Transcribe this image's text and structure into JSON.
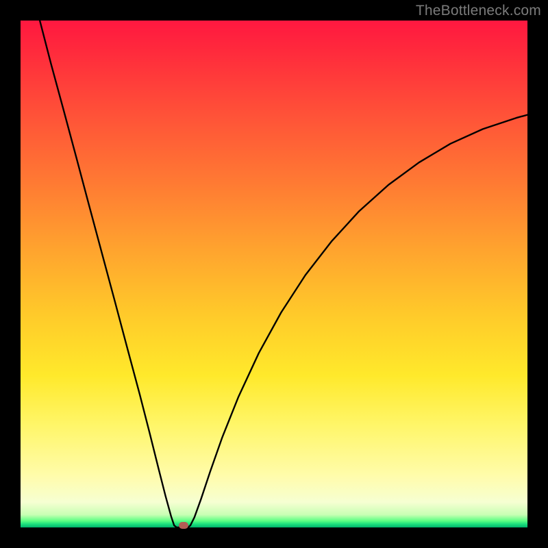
{
  "watermark": "TheBottleneck.com",
  "chart_data": {
    "type": "line",
    "title": "",
    "xlabel": "",
    "ylabel": "",
    "xlim": [
      0,
      1
    ],
    "ylim": [
      0,
      1
    ],
    "grid": false,
    "legend": false,
    "line_color": "#000000",
    "gradient_stops": [
      {
        "pos": 0.0,
        "color": "#ff1840"
      },
      {
        "pos": 0.18,
        "color": "#ff5038"
      },
      {
        "pos": 0.46,
        "color": "#ffa62e"
      },
      {
        "pos": 0.7,
        "color": "#ffe92b"
      },
      {
        "pos": 0.9,
        "color": "#fffcac"
      },
      {
        "pos": 0.985,
        "color": "#5cff83"
      },
      {
        "pos": 1.0,
        "color": "#00b36b"
      }
    ],
    "left_branch": [
      {
        "x": 0.038,
        "y": 1.0
      },
      {
        "x": 0.06,
        "y": 0.915
      },
      {
        "x": 0.085,
        "y": 0.823
      },
      {
        "x": 0.11,
        "y": 0.73
      },
      {
        "x": 0.135,
        "y": 0.636
      },
      {
        "x": 0.16,
        "y": 0.543
      },
      {
        "x": 0.185,
        "y": 0.45
      },
      {
        "x": 0.21,
        "y": 0.356
      },
      {
        "x": 0.235,
        "y": 0.263
      },
      {
        "x": 0.255,
        "y": 0.185
      },
      {
        "x": 0.272,
        "y": 0.117
      },
      {
        "x": 0.286,
        "y": 0.062
      },
      {
        "x": 0.297,
        "y": 0.022
      },
      {
        "x": 0.303,
        "y": 0.004
      },
      {
        "x": 0.308,
        "y": 0.0
      }
    ],
    "right_branch": [
      {
        "x": 0.33,
        "y": 0.0
      },
      {
        "x": 0.335,
        "y": 0.004
      },
      {
        "x": 0.343,
        "y": 0.02
      },
      {
        "x": 0.356,
        "y": 0.056
      },
      {
        "x": 0.374,
        "y": 0.11
      },
      {
        "x": 0.398,
        "y": 0.178
      },
      {
        "x": 0.43,
        "y": 0.258
      },
      {
        "x": 0.47,
        "y": 0.344
      },
      {
        "x": 0.514,
        "y": 0.424
      },
      {
        "x": 0.562,
        "y": 0.498
      },
      {
        "x": 0.614,
        "y": 0.565
      },
      {
        "x": 0.668,
        "y": 0.624
      },
      {
        "x": 0.726,
        "y": 0.676
      },
      {
        "x": 0.786,
        "y": 0.72
      },
      {
        "x": 0.848,
        "y": 0.757
      },
      {
        "x": 0.912,
        "y": 0.786
      },
      {
        "x": 0.978,
        "y": 0.808
      },
      {
        "x": 1.0,
        "y": 0.814
      }
    ],
    "marker": {
      "x": 0.321,
      "y": 0.0,
      "color": "#b35d55"
    }
  }
}
